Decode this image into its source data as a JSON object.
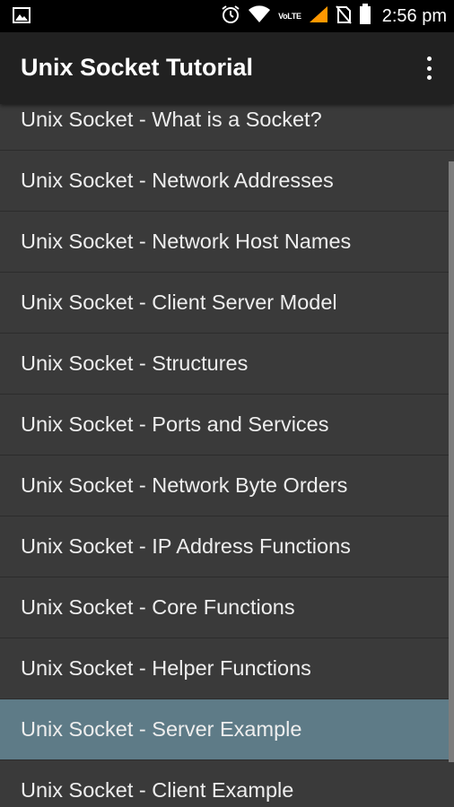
{
  "status_bar": {
    "time": "2:56 pm",
    "network_label": "VoLTE",
    "icons": [
      "image-icon",
      "alarm-icon",
      "wifi-icon",
      "signal-icon",
      "no-sim-icon",
      "battery-icon"
    ]
  },
  "app_bar": {
    "title": "Unix Socket Tutorial",
    "menu_icon": "overflow-menu-icon"
  },
  "colors": {
    "app_bar": "#212121",
    "list_background": "#3a3a3a",
    "selected_item": "#5e7b87",
    "accent": "#ff9800"
  },
  "list": {
    "selected_index": 10,
    "items": [
      {
        "label": "Unix Socket - What is a Socket?"
      },
      {
        "label": "Unix Socket - Network Addresses"
      },
      {
        "label": "Unix Socket - Network Host Names"
      },
      {
        "label": "Unix Socket - Client Server Model"
      },
      {
        "label": "Unix Socket - Structures"
      },
      {
        "label": "Unix Socket - Ports and Services"
      },
      {
        "label": "Unix Socket - Network Byte Orders"
      },
      {
        "label": "Unix Socket - IP Address Functions"
      },
      {
        "label": "Unix Socket - Core Functions"
      },
      {
        "label": "Unix Socket - Helper Functions"
      },
      {
        "label": "Unix Socket - Server Example"
      },
      {
        "label": "Unix Socket - Client Example"
      }
    ]
  }
}
